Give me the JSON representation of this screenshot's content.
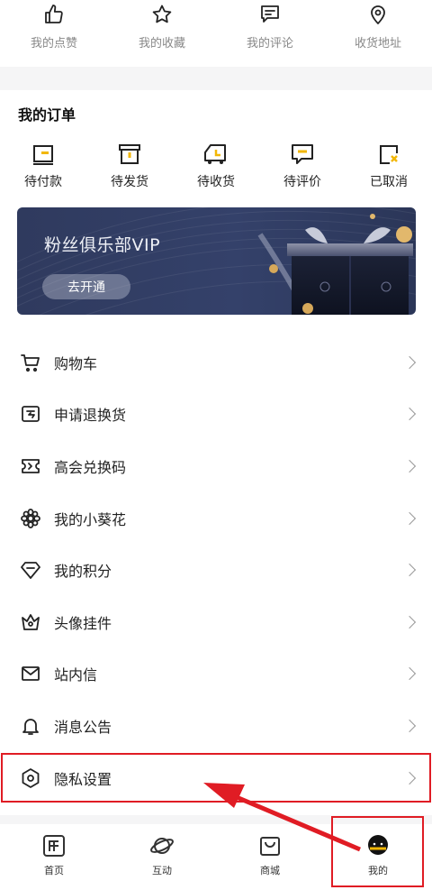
{
  "top_shortcuts": [
    {
      "label": "我的点赞",
      "icon": "thumbs-up-icon"
    },
    {
      "label": "我的收藏",
      "icon": "star-icon"
    },
    {
      "label": "我的评论",
      "icon": "comment-icon"
    },
    {
      "label": "收货地址",
      "icon": "location-pin-icon"
    }
  ],
  "orders": {
    "title": "我的订单",
    "items": [
      {
        "label": "待付款",
        "icon": "wallet-icon"
      },
      {
        "label": "待发货",
        "icon": "box-icon"
      },
      {
        "label": "待收货",
        "icon": "truck-icon"
      },
      {
        "label": "待评价",
        "icon": "review-icon"
      },
      {
        "label": "已取消",
        "icon": "cancel-icon"
      }
    ]
  },
  "vip_banner": {
    "title": "粉丝俱乐部VIP",
    "button_label": "去开通"
  },
  "menu": [
    {
      "label": "购物车",
      "icon": "cart-icon"
    },
    {
      "label": "申请退换货",
      "icon": "return-icon"
    },
    {
      "label": "高会兑换码",
      "icon": "ticket-icon"
    },
    {
      "label": "我的小葵花",
      "icon": "flower-icon"
    },
    {
      "label": "我的积分",
      "icon": "diamond-icon"
    },
    {
      "label": "头像挂件",
      "icon": "crown-icon"
    },
    {
      "label": "站内信",
      "icon": "mail-icon"
    },
    {
      "label": "消息公告",
      "icon": "bell-icon"
    },
    {
      "label": "隐私设置",
      "icon": "settings-icon"
    }
  ],
  "bottom_nav": [
    {
      "label": "首页",
      "icon": "home-icon"
    },
    {
      "label": "互动",
      "icon": "planet-icon"
    },
    {
      "label": "商城",
      "icon": "shopping-bag-icon"
    },
    {
      "label": "我的",
      "icon": "profile-icon"
    }
  ],
  "colors": {
    "accent": "#f2b705",
    "annotation_red": "#e01c24",
    "banner": "#2f3a5e"
  }
}
